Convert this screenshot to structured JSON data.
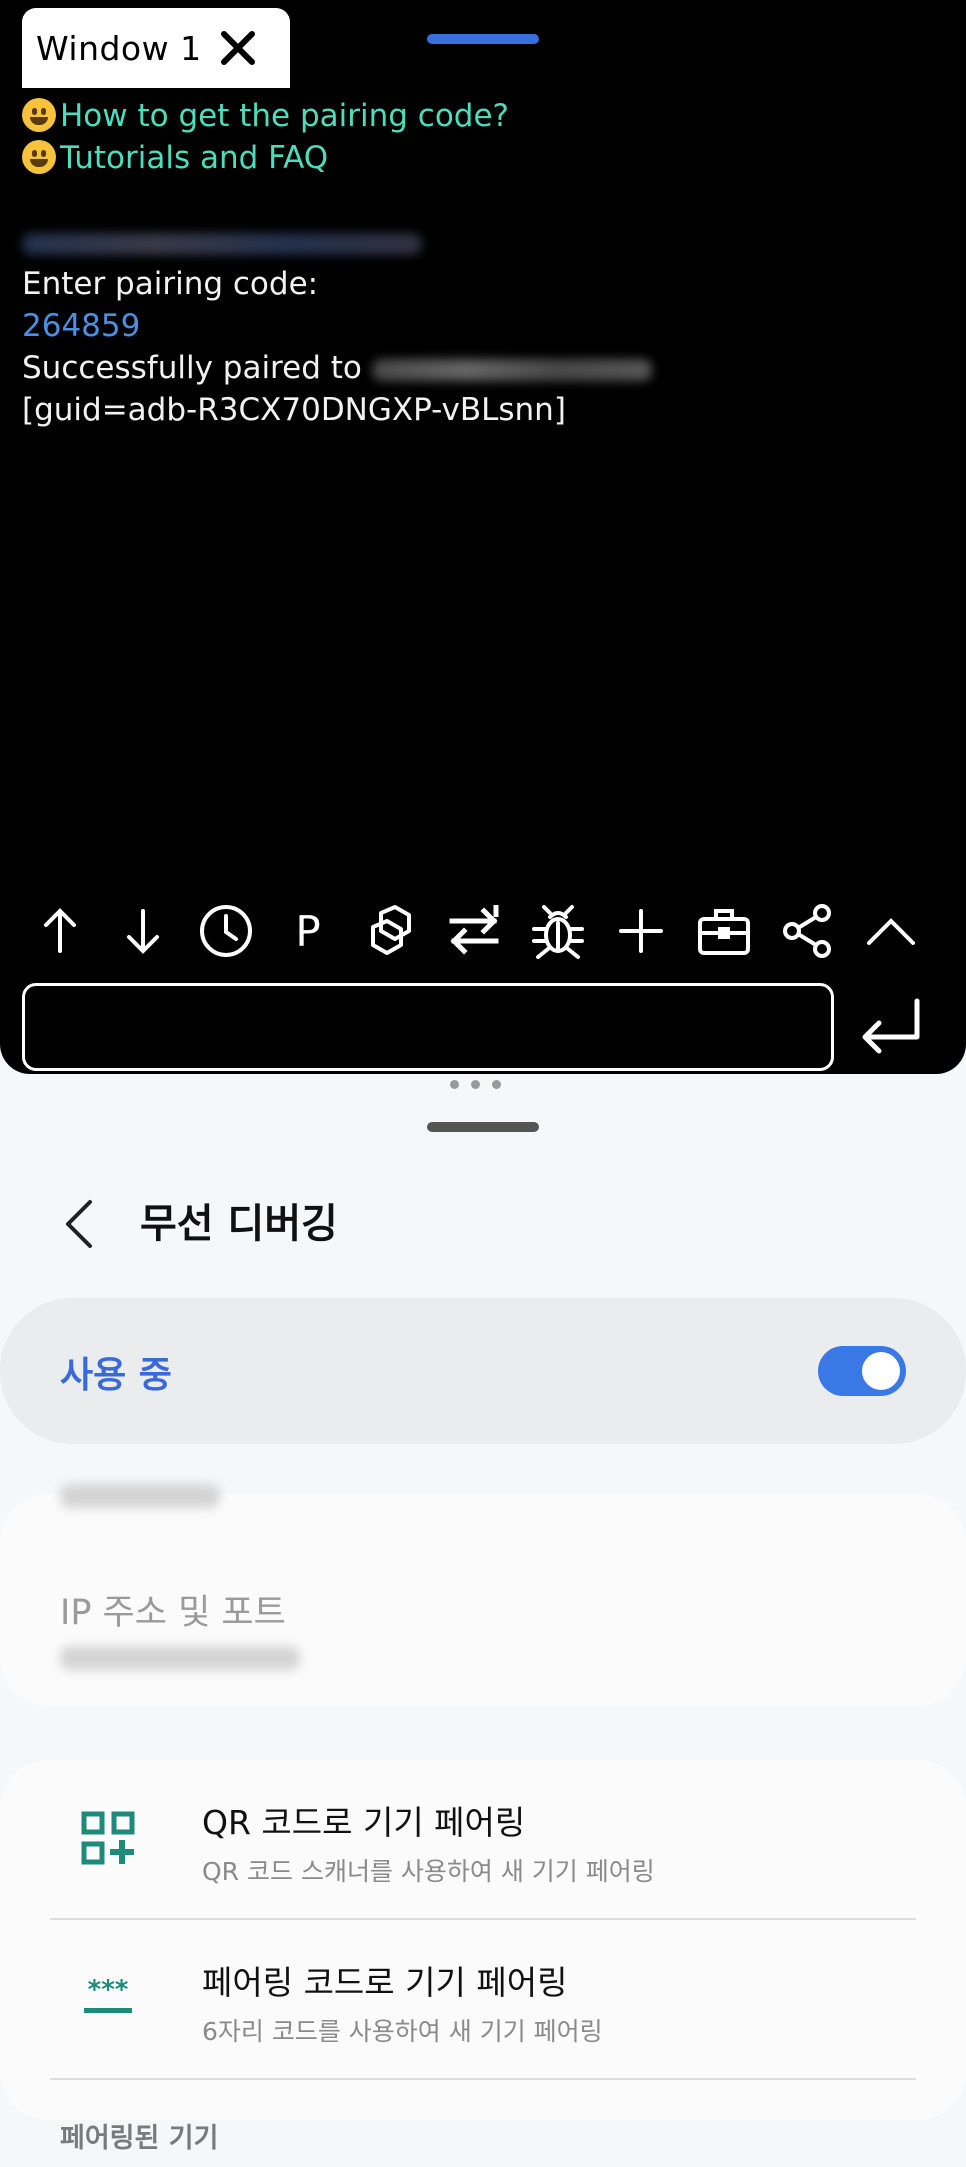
{
  "terminal": {
    "window_tab": "Window 1",
    "link_pairing": "How to get the pairing code?",
    "link_tutorials": "Tutorials and FAQ",
    "prompt_enter": "Enter pairing code:",
    "pairing_code": "264859",
    "paired_prefix": "Successfully paired to",
    "guid": "[guid=adb-R3CX70DNGXP-vBLsnn]",
    "toolbar_p": "P",
    "command_value": ""
  },
  "settings": {
    "title": "무선 디버깅",
    "master_label": "사용 중",
    "master_on": true,
    "ip_label": "IP 주소 및 포트",
    "qr_title": "QR 코드로 기기 페어링",
    "qr_sub": "QR 코드 스캐너를 사용하여 새 기기 페어링",
    "code_title": "페어링 코드로 기기 페어링",
    "code_sub": "6자리 코드를 사용하여 새 기기 페어링",
    "paired_section": "페어링된 기기"
  },
  "icons": [
    "close-icon",
    "arrow-up-icon",
    "arrow-down-icon",
    "history-icon",
    "package-icon",
    "swap-icon",
    "bug-icon",
    "plus-icon",
    "toolbox-icon",
    "share-icon",
    "chevron-up-icon",
    "enter-icon",
    "back-icon",
    "qr-code-icon",
    "pairing-code-icon"
  ],
  "colors": {
    "link": "#4ddcbc",
    "code": "#4a8fe0",
    "accent": "#3a78e6",
    "qr_icon": "#1e8a7a"
  }
}
